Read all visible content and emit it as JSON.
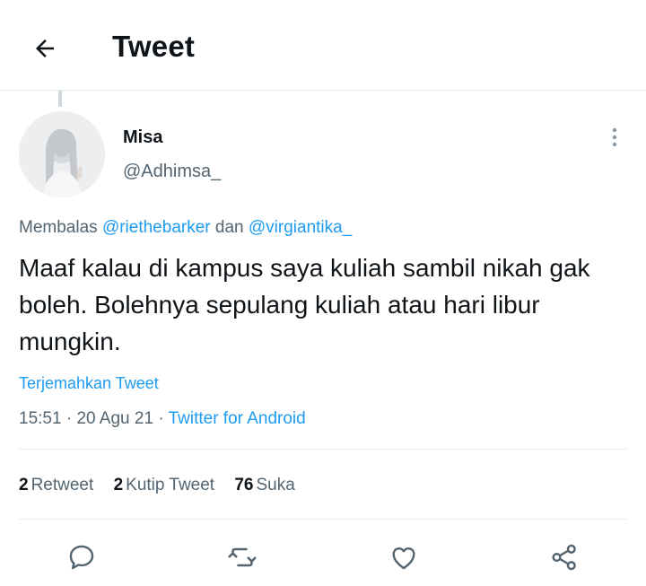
{
  "header": {
    "title": "Tweet",
    "back_icon": "arrow-left-icon"
  },
  "author": {
    "name": "Misa",
    "handle": "@Adhimsa_"
  },
  "replying": {
    "prefix": "Membalas",
    "user1": "@riethebarker",
    "conj": "dan",
    "user2": "@virgiantika_"
  },
  "tweet": {
    "text": "Maaf kalau di kampus saya kuliah sambil nikah gak boleh. Bolehnya sepulang kuliah atau hari libur mungkin."
  },
  "translate_label": "Terjemahkan Tweet",
  "meta": {
    "time": "15:51",
    "date": "20 Agu 21",
    "source": "Twitter for Android",
    "sep": "·"
  },
  "stats": {
    "retweets_count": "2",
    "retweets_label": "Retweet",
    "quotes_count": "2",
    "quotes_label": "Kutip Tweet",
    "likes_count": "76",
    "likes_label": "Suka"
  },
  "actions": [
    "reply-icon",
    "retweet-icon",
    "like-icon",
    "share-icon"
  ],
  "colors": {
    "link": "#1d9bf0",
    "secondary": "#536471",
    "text": "#0f1419",
    "divider": "#e6ecf0"
  }
}
